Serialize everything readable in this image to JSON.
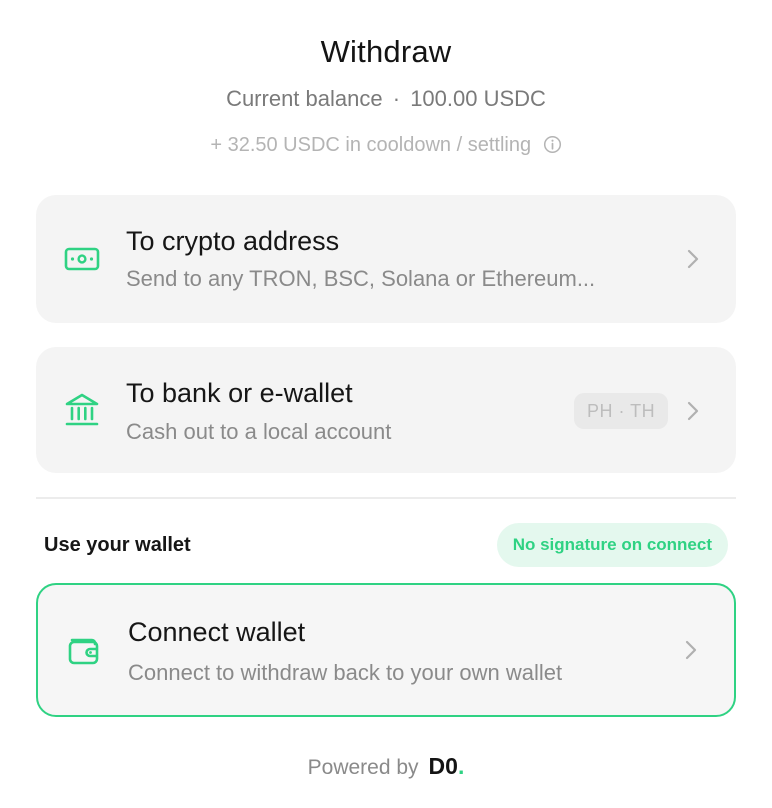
{
  "header": {
    "title": "Withdraw",
    "balance_label": "Current balance",
    "balance_separator": "·",
    "balance_value": "100.00 USDC",
    "cooldown_text": "+ 32.50 USDC in cooldown / settling"
  },
  "options": {
    "crypto": {
      "title": "To crypto address",
      "subtitle": "Send to any TRON, BSC, Solana or Ethereum..."
    },
    "bank": {
      "title": "To bank or e-wallet",
      "subtitle": "Cash out to a local account",
      "region_badge": "PH · TH"
    }
  },
  "wallet_section": {
    "label": "Use your wallet",
    "badge": "No signature on connect",
    "connect": {
      "title": "Connect wallet",
      "subtitle": "Connect to withdraw back to your own wallet"
    }
  },
  "footer": {
    "powered_by": "Powered by",
    "brand": "D0",
    "brand_dot": "."
  },
  "colors": {
    "accent": "#2fd283",
    "card_bg": "#f4f4f4",
    "badge_bg": "#e4f8ee"
  },
  "icons": {
    "info": "info-icon",
    "crypto": "banknote-icon",
    "bank": "bank-icon",
    "wallet": "wallet-icon",
    "chevron": "chevron-right-icon"
  }
}
